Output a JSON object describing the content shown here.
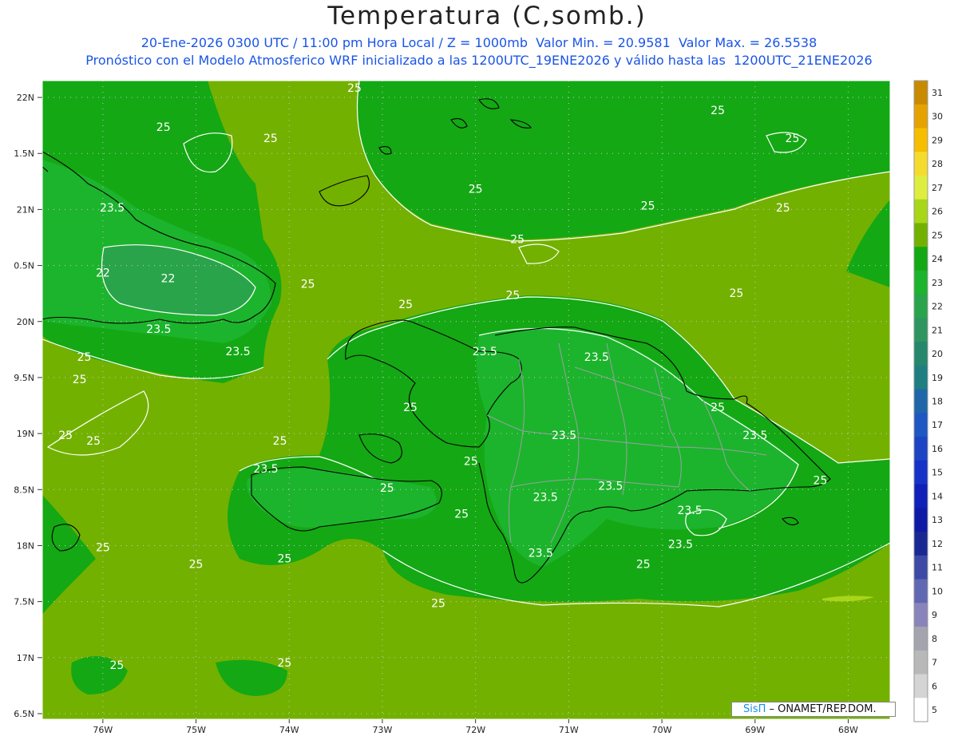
{
  "header": {
    "title": "Temperatura (C,somb.)",
    "line1": "20-Ene-2026 0300 UTC / 11:00 pm Hora Local / Z = 1000mb  Valor Min. = 20.9581  Valor Max. = 26.5538",
    "line2": "Pronóstico con el Modelo Atmosferico WRF inicializado a las 1200UTC_19ENE2026 y válido hasta las  1200UTC_21ENE2026"
  },
  "map": {
    "lon_range": [
      -76.65,
      -67.55
    ],
    "lat_range": [
      16.45,
      22.15
    ],
    "lat_labels": [
      "22N",
      "1.5N",
      "21N",
      "0.5N",
      "20N",
      "9.5N",
      "19N",
      "8.5N",
      "18N",
      "7.5N",
      "17N",
      "6.5N"
    ],
    "lat_values": [
      22,
      21.5,
      21,
      20.5,
      20,
      19.5,
      19,
      18.5,
      18,
      17.5,
      17,
      16.5
    ],
    "lon_labels": [
      "76W",
      "75W",
      "74W",
      "73W",
      "72W",
      "71W",
      "70W",
      "69W",
      "68W"
    ],
    "lon_values": [
      -76,
      -75,
      -74,
      -73,
      -72,
      -71,
      -70,
      -69,
      -68
    ],
    "contour_labels": [
      {
        "text": "25",
        "lon": -73.3,
        "lat": 22.05
      },
      {
        "text": "25",
        "lon": -75.35,
        "lat": 21.7
      },
      {
        "text": "25",
        "lon": -74.2,
        "lat": 21.6
      },
      {
        "text": "25",
        "lon": -69.4,
        "lat": 21.85
      },
      {
        "text": "25",
        "lon": -68.6,
        "lat": 21.6
      },
      {
        "text": "25",
        "lon": -72.0,
        "lat": 21.15
      },
      {
        "text": "25",
        "lon": -70.15,
        "lat": 21.0
      },
      {
        "text": "25",
        "lon": -68.7,
        "lat": 20.98
      },
      {
        "text": "25",
        "lon": -71.55,
        "lat": 20.7
      },
      {
        "text": "25",
        "lon": -73.8,
        "lat": 20.3
      },
      {
        "text": "25",
        "lon": -71.6,
        "lat": 20.2
      },
      {
        "text": "25",
        "lon": -69.2,
        "lat": 20.22
      },
      {
        "text": "25",
        "lon": -72.75,
        "lat": 20.12
      },
      {
        "text": "23.5",
        "lon": -75.9,
        "lat": 20.98
      },
      {
        "text": "22",
        "lon": -76.0,
        "lat": 20.4
      },
      {
        "text": "22",
        "lon": -75.3,
        "lat": 20.35
      },
      {
        "text": "23.5",
        "lon": -75.4,
        "lat": 19.9
      },
      {
        "text": "23.5",
        "lon": -74.55,
        "lat": 19.7
      },
      {
        "text": "25",
        "lon": -76.2,
        "lat": 19.65
      },
      {
        "text": "25",
        "lon": -76.25,
        "lat": 19.45
      },
      {
        "text": "25",
        "lon": -76.4,
        "lat": 18.95
      },
      {
        "text": "25",
        "lon": -76.1,
        "lat": 18.9
      },
      {
        "text": "23.5",
        "lon": -71.9,
        "lat": 19.7
      },
      {
        "text": "23.5",
        "lon": -70.7,
        "lat": 19.65
      },
      {
        "text": "25",
        "lon": -72.7,
        "lat": 19.2
      },
      {
        "text": "25",
        "lon": -69.4,
        "lat": 19.2
      },
      {
        "text": "23.5",
        "lon": -71.05,
        "lat": 18.95
      },
      {
        "text": "23.5",
        "lon": -69.0,
        "lat": 18.95
      },
      {
        "text": "25",
        "lon": -74.1,
        "lat": 18.9
      },
      {
        "text": "25",
        "lon": -72.05,
        "lat": 18.72
      },
      {
        "text": "23.5",
        "lon": -74.25,
        "lat": 18.65
      },
      {
        "text": "25",
        "lon": -72.95,
        "lat": 18.48
      },
      {
        "text": "23.5",
        "lon": -70.55,
        "lat": 18.5
      },
      {
        "text": "23.5",
        "lon": -71.25,
        "lat": 18.4
      },
      {
        "text": "25",
        "lon": -68.3,
        "lat": 18.55
      },
      {
        "text": "23.5",
        "lon": -69.7,
        "lat": 18.28
      },
      {
        "text": "25",
        "lon": -72.15,
        "lat": 18.25
      },
      {
        "text": "23.5",
        "lon": -69.8,
        "lat": 17.98
      },
      {
        "text": "23.5",
        "lon": -71.3,
        "lat": 17.9
      },
      {
        "text": "25",
        "lon": -76.0,
        "lat": 17.95
      },
      {
        "text": "25",
        "lon": -74.05,
        "lat": 17.85
      },
      {
        "text": "25",
        "lon": -75.0,
        "lat": 17.8
      },
      {
        "text": "25",
        "lon": -70.2,
        "lat": 17.8
      },
      {
        "text": "25",
        "lon": -72.4,
        "lat": 17.45
      },
      {
        "text": "25",
        "lon": -75.85,
        "lat": 16.9
      },
      {
        "text": "25",
        "lon": -74.05,
        "lat": 16.92
      }
    ]
  },
  "colorbar": {
    "labels": [
      "31",
      "30",
      "29",
      "28",
      "27",
      "26",
      "25",
      "24",
      "23",
      "22",
      "21",
      "20",
      "19",
      "18",
      "17",
      "16",
      "15",
      "14",
      "13",
      "12",
      "11",
      "10",
      "9",
      "8",
      "7",
      "6",
      "5"
    ],
    "colors": [
      "#c88a00",
      "#e6a200",
      "#f7bd00",
      "#f5db2e",
      "#ddee40",
      "#a8d618",
      "#73b100",
      "#14a814",
      "#1cb42c",
      "#2aa44a",
      "#2e9560",
      "#25876c",
      "#1e7e82",
      "#1e66a8",
      "#1e56c4",
      "#1c44c4",
      "#1632c8",
      "#1020b8",
      "#0e1aa6",
      "#1a2894",
      "#3c4aa6",
      "#6068b4",
      "#8a84bc",
      "#a4a4ae",
      "#b8b8b8",
      "#d4d4d4",
      "#ffffff"
    ]
  },
  "credit": {
    "brand": "SisΠ",
    "text": " – ONAMET/REP.DOM."
  }
}
